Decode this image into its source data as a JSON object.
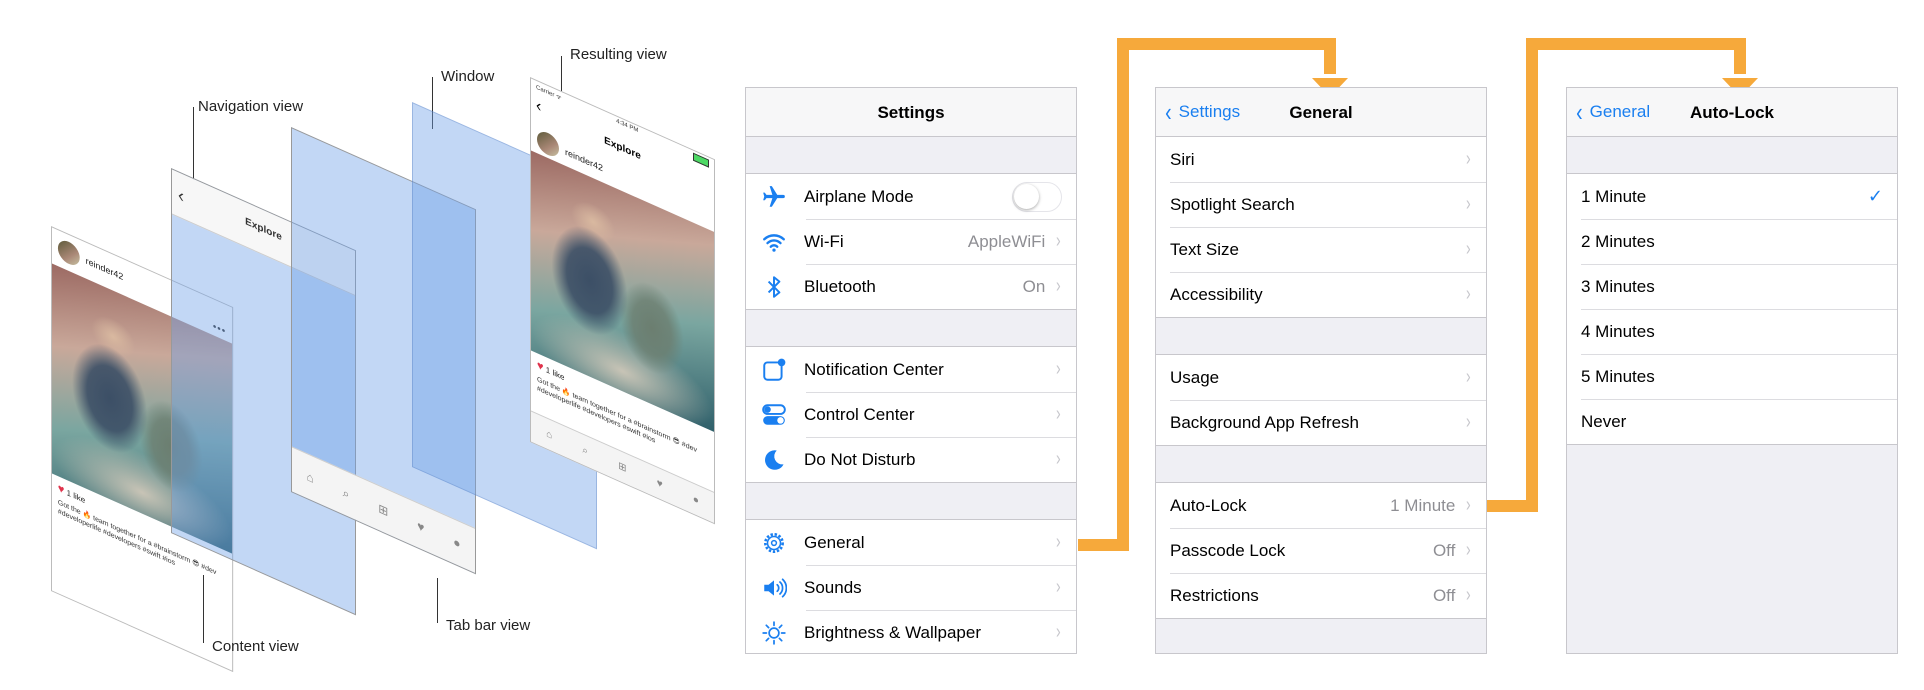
{
  "diagram": {
    "callouts": {
      "navigation_view": "Navigation view",
      "window": "Window",
      "resulting_view": "Resulting view",
      "content_view": "Content view",
      "tab_bar_view": "Tab bar view"
    },
    "post": {
      "nav_title": "Explore",
      "username": "reinder42",
      "likes": "1 like",
      "caption": "Got the 🔥 team together for a #brainstorm 😎 #dev #developerlife #developers #swift #ios",
      "status_carrier": "Carrier ᯤ",
      "status_time": "4:34 PM"
    }
  },
  "screens": {
    "settings": {
      "title": "Settings",
      "group1": [
        {
          "icon": "airplane-icon",
          "label": "Airplane Mode",
          "toggle": false
        },
        {
          "icon": "wifi-icon",
          "label": "Wi-Fi",
          "value": "AppleWiFi"
        },
        {
          "icon": "bluetooth-icon",
          "label": "Bluetooth",
          "value": "On"
        }
      ],
      "group2": [
        {
          "icon": "notification-center-icon",
          "label": "Notification Center"
        },
        {
          "icon": "control-center-icon",
          "label": "Control Center"
        },
        {
          "icon": "do-not-disturb-icon",
          "label": "Do Not Disturb"
        }
      ],
      "group3": [
        {
          "icon": "gear-icon",
          "label": "General"
        },
        {
          "icon": "speaker-icon",
          "label": "Sounds"
        },
        {
          "icon": "sun-icon",
          "label": "Brightness & Wallpaper"
        }
      ]
    },
    "general": {
      "back": "Settings",
      "title": "General",
      "group1": [
        "Siri",
        "Spotlight Search",
        "Text Size",
        "Accessibility"
      ],
      "group2": [
        "Usage",
        "Background App Refresh"
      ],
      "group3": [
        {
          "label": "Auto-Lock",
          "value": "1 Minute"
        },
        {
          "label": "Passcode Lock",
          "value": "Off"
        },
        {
          "label": "Restrictions",
          "value": "Off"
        }
      ]
    },
    "autolock": {
      "back": "General",
      "title": "Auto-Lock",
      "options": [
        "1 Minute",
        "2 Minutes",
        "3 Minutes",
        "4 Minutes",
        "5 Minutes",
        "Never"
      ],
      "selected": "1 Minute"
    }
  },
  "colors": {
    "accent": "#1a7ff0",
    "connector": "#f6a93b",
    "layer_blue": "#9bbbe8"
  }
}
